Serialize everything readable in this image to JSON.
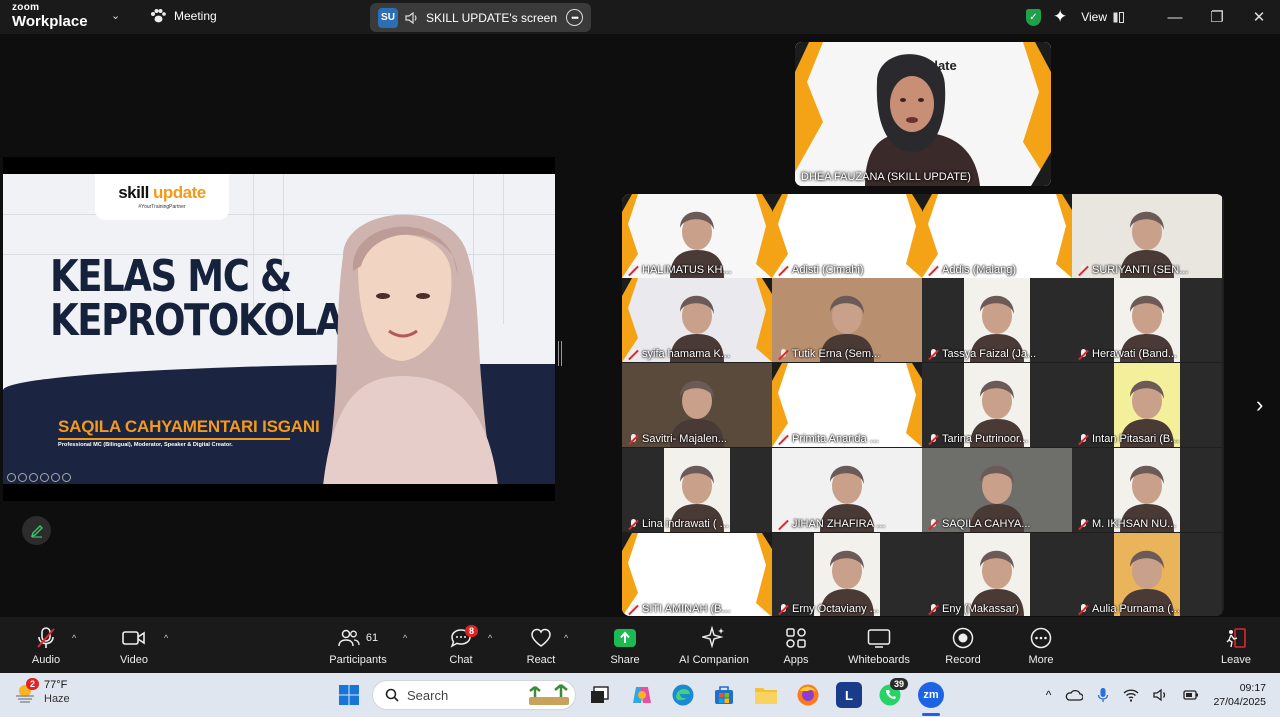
{
  "titlebar": {
    "brand_top": "zoom",
    "brand_bottom": "Workplace",
    "meeting_label": "Meeting",
    "screen_badge": "SU",
    "screen_label": "SKILL UPDATE's screen",
    "view_label": "View"
  },
  "slide": {
    "logo_skill": "skill ",
    "logo_update": "update",
    "logo_tagline": "#YourTrainingPartner",
    "title_line1": "KELAS MC &",
    "title_line2": "KEPROTOKOLAN",
    "speaker_name": "SAQILA CAHYAMENTARI ISGANI",
    "speaker_role": "Professional MC (Bilingual), Moderator, Speaker & Digital Creator."
  },
  "active_speaker": {
    "name": "DHEA FAUZANA (SKILL UPDATE)"
  },
  "participants": [
    "HALIMATUS KH...",
    "Adisti (Cimahi)",
    "Addis (Malang)",
    "SURIYANTI (SEN...",
    "syifa hamama K...",
    "Tutik Erna (Sem...",
    "Tassya Faizal (Ja...",
    "Herawati (Band...",
    "Savitri- Majalen...",
    "Primita Ananda ...",
    "Tarina Putrinoor...",
    "Intan Pitasari (B...",
    "Lina indrawati ( ...",
    "JIHAN ZHAFIRA ...",
    "SAQILA CAHYA...",
    "M. IKHSAN NU...",
    "SITI AMINAH (B...",
    "Erny Octaviany ...",
    "Eny (Makassar)",
    "Aulia Purnama (..."
  ],
  "toolbar": {
    "audio": "Audio",
    "video": "Video",
    "participants": "Participants",
    "participants_count": "61",
    "chat": "Chat",
    "chat_badge": "8",
    "react": "React",
    "share": "Share",
    "ai_companion": "AI Companion",
    "apps": "Apps",
    "whiteboards": "Whiteboards",
    "record": "Record",
    "more": "More",
    "leave": "Leave"
  },
  "taskbar": {
    "weather_badge": "2",
    "temperature": "77°F",
    "condition": "Haze",
    "search_placeholder": "Search",
    "launcher_letter": "L",
    "whatsapp_badge": "39",
    "zoom_label": "zm",
    "time": "09:17",
    "date": "27/04/2025"
  },
  "colors": {
    "accent_orange": "#f39a1b",
    "navy": "#1b2440",
    "mute_red": "#e0262d",
    "share_green": "#1db954"
  }
}
